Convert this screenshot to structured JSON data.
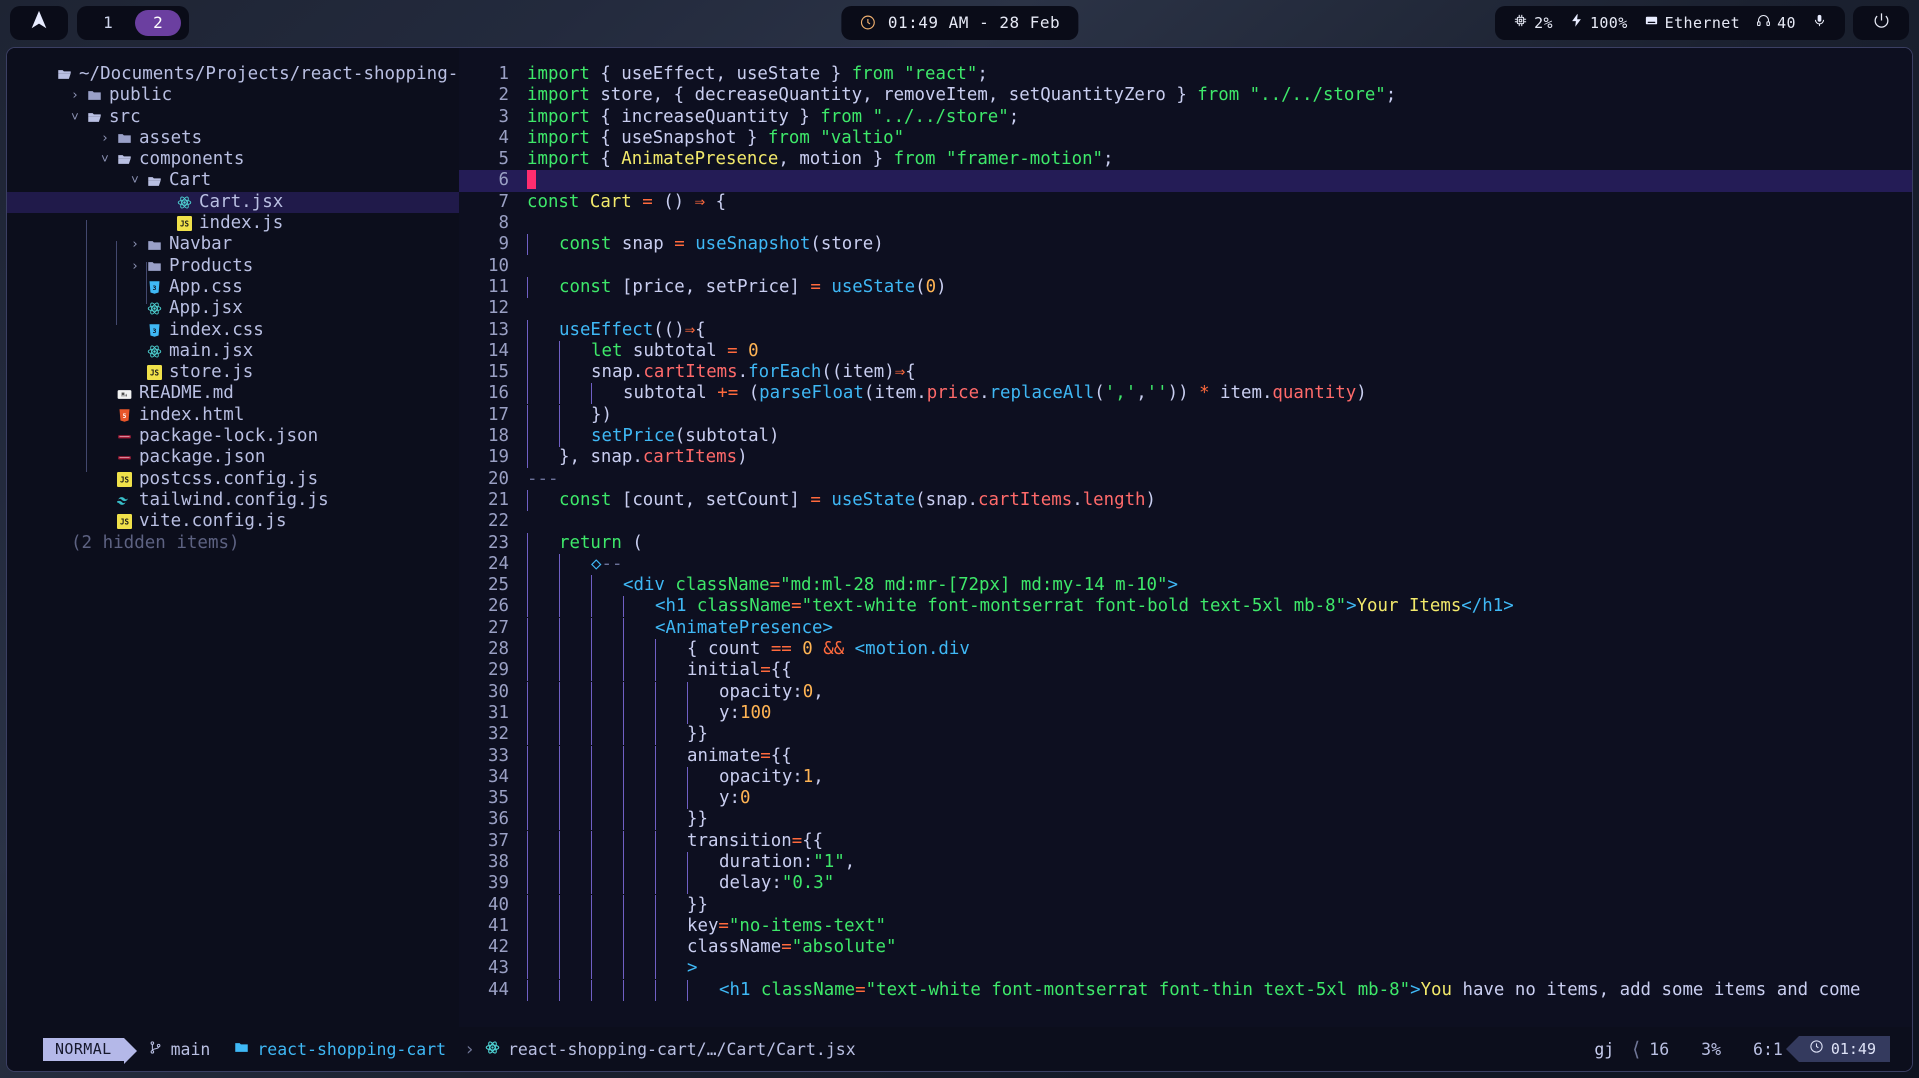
{
  "topbar": {
    "launcher_icon": "arch-logo-icon",
    "workspaces": [
      {
        "label": "1",
        "active": false
      },
      {
        "label": "2",
        "active": true
      }
    ],
    "clock": {
      "icon": "clock-icon",
      "text": "01:49 AM - 28 Feb"
    },
    "system": [
      {
        "icon": "cpu-icon",
        "label": "2%"
      },
      {
        "icon": "plug-icon",
        "label": "100%"
      },
      {
        "icon": "ethernet-icon",
        "label": "Ethernet"
      },
      {
        "icon": "headphones-icon",
        "label": "40"
      },
      {
        "icon": "microphone-icon",
        "label": ""
      }
    ],
    "power_icon": "power-icon"
  },
  "tree": {
    "root": {
      "icon": "folder-open-icon",
      "label": "~/Documents/Projects/react-shopping-c"
    },
    "items": [
      {
        "indent": 1,
        "chev": "›",
        "icon": "folder-icon",
        "label": "public",
        "selected": false
      },
      {
        "indent": 1,
        "chev": "˅",
        "icon": "folder-open-icon",
        "label": "src",
        "selected": false
      },
      {
        "indent": 2,
        "chev": "›",
        "icon": "folder-icon",
        "label": "assets",
        "selected": false
      },
      {
        "indent": 2,
        "chev": "˅",
        "icon": "folder-open-icon",
        "label": "components",
        "selected": false
      },
      {
        "indent": 3,
        "chev": "˅",
        "icon": "folder-open-icon",
        "label": "Cart",
        "selected": false
      },
      {
        "indent": 4,
        "chev": "",
        "icon": "react-icon",
        "label": "Cart.jsx",
        "selected": true
      },
      {
        "indent": 4,
        "chev": "",
        "icon": "js-icon",
        "label": "index.js",
        "selected": false
      },
      {
        "indent": 3,
        "chev": "›",
        "icon": "folder-icon",
        "label": "Navbar",
        "selected": false
      },
      {
        "indent": 3,
        "chev": "›",
        "icon": "folder-icon",
        "label": "Products",
        "selected": false
      },
      {
        "indent": 3,
        "chev": "",
        "icon": "css-icon",
        "label": "App.css",
        "selected": false
      },
      {
        "indent": 3,
        "chev": "",
        "icon": "react-icon",
        "label": "App.jsx",
        "selected": false
      },
      {
        "indent": 3,
        "chev": "",
        "icon": "css-icon",
        "label": "index.css",
        "selected": false
      },
      {
        "indent": 3,
        "chev": "",
        "icon": "react-icon",
        "label": "main.jsx",
        "selected": false
      },
      {
        "indent": 3,
        "chev": "",
        "icon": "js-icon",
        "label": "store.js",
        "selected": false
      },
      {
        "indent": 2,
        "chev": "",
        "icon": "markdown-icon",
        "label": "README.md",
        "selected": false
      },
      {
        "indent": 2,
        "chev": "",
        "icon": "html-icon",
        "label": "index.html",
        "selected": false
      },
      {
        "indent": 2,
        "chev": "",
        "icon": "json-icon",
        "label": "package-lock.json",
        "selected": false
      },
      {
        "indent": 2,
        "chev": "",
        "icon": "json-icon",
        "label": "package.json",
        "selected": false
      },
      {
        "indent": 2,
        "chev": "",
        "icon": "js-icon",
        "label": "postcss.config.js",
        "selected": false
      },
      {
        "indent": 2,
        "chev": "",
        "icon": "tailwind-icon",
        "label": "tailwind.config.js",
        "selected": false
      },
      {
        "indent": 2,
        "chev": "",
        "icon": "js-icon",
        "label": "vite.config.js",
        "selected": false
      }
    ],
    "hidden_note": "(2 hidden items)"
  },
  "editor": {
    "language": "jsx",
    "current_line": 6,
    "lines": [
      {
        "n": 1,
        "text": "import { useEffect, useState } from \"react\";"
      },
      {
        "n": 2,
        "text": "import store, { decreaseQuantity, removeItem, setQuantityZero } from \"../../store\";"
      },
      {
        "n": 3,
        "text": "import { increaseQuantity } from \"../../store\";"
      },
      {
        "n": 4,
        "text": "import { useSnapshot } from \"valtio\""
      },
      {
        "n": 5,
        "text": "import { AnimatePresence, motion } from \"framer-motion\";"
      },
      {
        "n": 6,
        "text": ""
      },
      {
        "n": 7,
        "text": "const Cart = () => {"
      },
      {
        "n": 8,
        "text": ""
      },
      {
        "n": 9,
        "text": "    const snap = useSnapshot(store)"
      },
      {
        "n": 10,
        "text": ""
      },
      {
        "n": 11,
        "text": "    const [price, setPrice] = useState(0)"
      },
      {
        "n": 12,
        "text": ""
      },
      {
        "n": 13,
        "text": "    useEffect(()=>{"
      },
      {
        "n": 14,
        "text": "        let subtotal = 0"
      },
      {
        "n": 15,
        "text": "        snap.cartItems.forEach((item)=>{"
      },
      {
        "n": 16,
        "text": "            subtotal += (parseFloat(item.price.replaceAll(',','')) * item.quantity)"
      },
      {
        "n": 17,
        "text": "        })"
      },
      {
        "n": 18,
        "text": "        setPrice(subtotal)"
      },
      {
        "n": 19,
        "text": "    }, snap.cartItems)"
      },
      {
        "n": 20,
        "text": "---"
      },
      {
        "n": 21,
        "text": "    const [count, setCount] = useState(snap.cartItems.length)"
      },
      {
        "n": 22,
        "text": ""
      },
      {
        "n": 23,
        "text": "    return ("
      },
      {
        "n": 24,
        "text": "        <>--"
      },
      {
        "n": 25,
        "text": "            <div className=\"md:ml-28 md:mr-[72px] md:my-14 m-10\">"
      },
      {
        "n": 26,
        "text": "                <h1 className=\"text-white font-montserrat font-bold text-5xl mb-8\">Your Items</h1>"
      },
      {
        "n": 27,
        "text": "                <AnimatePresence>"
      },
      {
        "n": 28,
        "text": "                    { count == 0 && <motion.div"
      },
      {
        "n": 29,
        "text": "                    initial={{"
      },
      {
        "n": 30,
        "text": "                        opacity:0,"
      },
      {
        "n": 31,
        "text": "                        y:100"
      },
      {
        "n": 32,
        "text": "                    }}"
      },
      {
        "n": 33,
        "text": "                    animate={{"
      },
      {
        "n": 34,
        "text": "                        opacity:1,"
      },
      {
        "n": 35,
        "text": "                        y:0"
      },
      {
        "n": 36,
        "text": "                    }}"
      },
      {
        "n": 37,
        "text": "                    transition={{"
      },
      {
        "n": 38,
        "text": "                        duration:\"1\","
      },
      {
        "n": 39,
        "text": "                        delay:\"0.3\""
      },
      {
        "n": 40,
        "text": "                    }}"
      },
      {
        "n": 41,
        "text": "                    key=\"no-items-text\""
      },
      {
        "n": 42,
        "text": "                    className=\"absolute\""
      },
      {
        "n": 43,
        "text": "                    >"
      },
      {
        "n": 44,
        "text": "                        <h1 className=\"text-white font-montserrat font-thin text-5xl mb-8\">You have no items, add some items and come"
      }
    ]
  },
  "statusbar": {
    "mode": "NORMAL",
    "branch_icon": "git-branch-icon",
    "branch": "main",
    "repo_icon": "repo-icon",
    "repo": "react-shopping-cart",
    "separator": "›",
    "file_icon": "react-icon",
    "file_path": "react-shopping-cart/…/Cart/Cart.jsx",
    "lang_badge": "gj",
    "lsp_icon": "chevron-left-icon",
    "lsp_count": "16",
    "scroll_percent": "3%",
    "cursor_position": "6:1",
    "time_icon": "clock-icon",
    "time": "01:49"
  },
  "colors": {
    "accent_purple": "#6b3fa0",
    "cursor_pink": "#ff2d6f",
    "bg_window": "#0d0f1e",
    "bg_code": "#0d0f20",
    "current_line": "#241c56",
    "selection": "#201a4a"
  }
}
